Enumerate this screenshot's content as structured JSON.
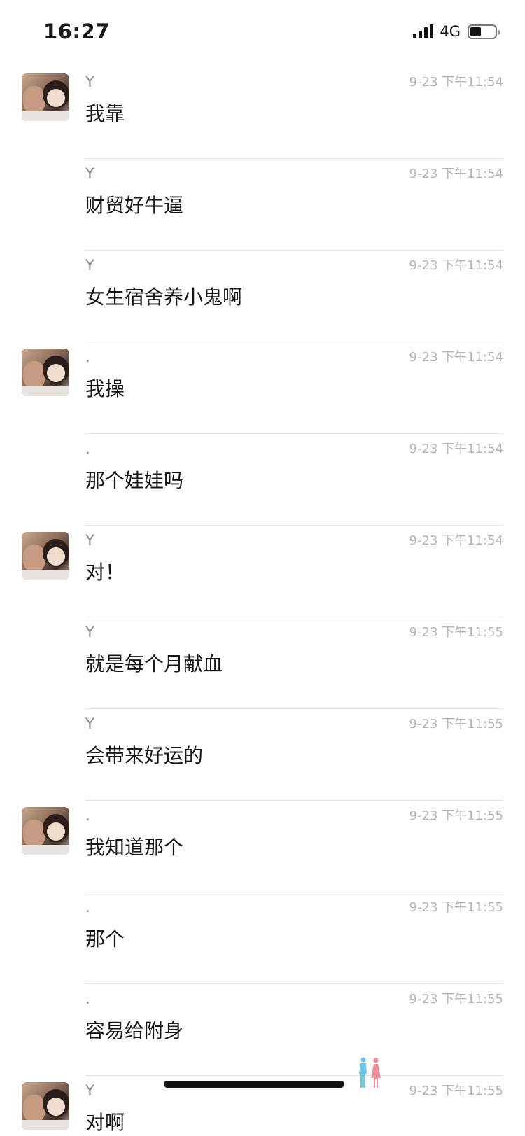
{
  "status_bar": {
    "time": "16:27",
    "network": "4G",
    "signal_bars": 4,
    "battery_level": 0.45
  },
  "messages": [
    {
      "sender": "Y",
      "time": "9-23 下午11:54",
      "text": "我靠",
      "show_avatar": true
    },
    {
      "sender": "Y",
      "time": "9-23 下午11:54",
      "text": "财贸好牛逼",
      "show_avatar": false
    },
    {
      "sender": "Y",
      "time": "9-23 下午11:54",
      "text": "女生宿舍养小鬼啊",
      "show_avatar": false
    },
    {
      "sender": ".",
      "time": "9-23 下午11:54",
      "text": "我操",
      "show_avatar": true
    },
    {
      "sender": ".",
      "time": "9-23 下午11:54",
      "text": "那个娃娃吗",
      "show_avatar": false
    },
    {
      "sender": "Y",
      "time": "9-23 下午11:54",
      "text": "对！",
      "show_avatar": true
    },
    {
      "sender": "Y",
      "time": "9-23 下午11:55",
      "text": "就是每个月献血",
      "show_avatar": false
    },
    {
      "sender": "Y",
      "time": "9-23 下午11:55",
      "text": "会带来好运的",
      "show_avatar": false
    },
    {
      "sender": ".",
      "time": "9-23 下午11:55",
      "text": "我知道那个",
      "show_avatar": true
    },
    {
      "sender": ".",
      "time": "9-23 下午11:55",
      "text": "那个",
      "show_avatar": false
    },
    {
      "sender": ".",
      "time": "9-23 下午11:55",
      "text": "容易给附身",
      "show_avatar": false
    },
    {
      "sender": "Y",
      "time": "9-23 下午11:55",
      "text": "对啊",
      "show_avatar": true
    }
  ],
  "colors": {
    "timestamp": "#b5b5b5",
    "sender": "#8a8a8a",
    "divider": "#e3e3e3",
    "figure_left": "#6cc7e8",
    "figure_right": "#ef8f9c"
  }
}
